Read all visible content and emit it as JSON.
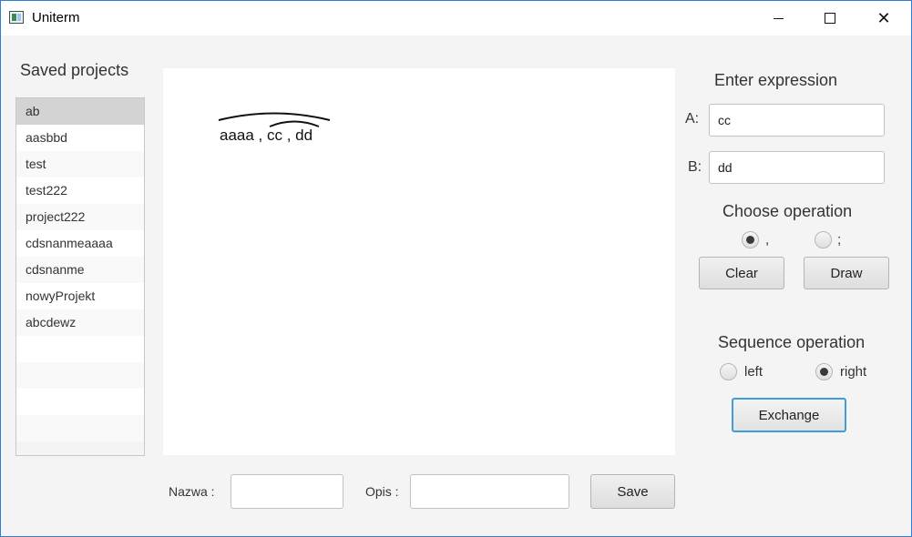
{
  "window": {
    "title": "Uniterm",
    "minimize_icon": "minimize-icon",
    "maximize_icon": "maximize-icon",
    "close_icon": "close-icon",
    "close_glyph": "✕"
  },
  "saved_projects": {
    "title": "Saved projects",
    "selected_index": 0,
    "items": [
      "ab",
      "aasbbd",
      "test",
      "test222",
      "project222",
      "cdsnanmeaaaa",
      "cdsnanme",
      "nowyProjekt",
      "abcdewz"
    ]
  },
  "canvas": {
    "expression_text": "aaaa , cc , dd"
  },
  "expression": {
    "title": "Enter expression",
    "a_label": "A:",
    "a_value": "cc",
    "b_label": "B:",
    "b_value": "dd"
  },
  "operation": {
    "title": "Choose operation",
    "options": [
      {
        "label": ",",
        "checked": true
      },
      {
        "label": ";",
        "checked": false
      }
    ],
    "clear_label": "Clear",
    "draw_label": "Draw"
  },
  "sequence": {
    "title": "Sequence operation",
    "options": [
      {
        "label": "left",
        "checked": false
      },
      {
        "label": "right",
        "checked": true
      }
    ],
    "exchange_label": "Exchange"
  },
  "footer": {
    "nazwa_label": "Nazwa :",
    "nazwa_value": "",
    "opis_label": "Opis :",
    "opis_value": "",
    "save_label": "Save"
  },
  "colors": {
    "focus_border": "#3f9ed8",
    "window_border": "#2b7fd6",
    "selected_row": "#d3d3d3"
  }
}
